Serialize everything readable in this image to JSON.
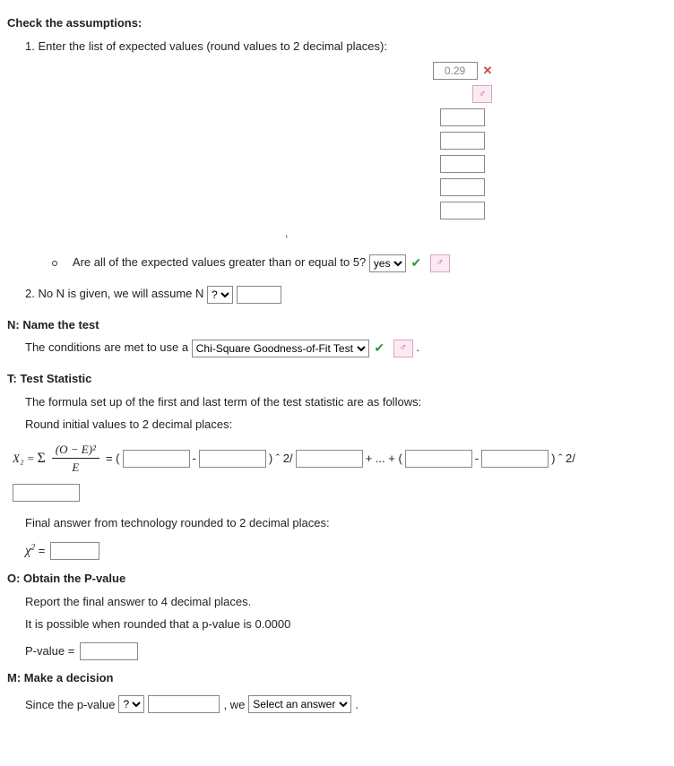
{
  "headings": {
    "check": "Check the assumptions:",
    "enter_list": "1. Enter the list of expected values (round values to 2 decimal places):",
    "all_ge5": "Are all of the expected values greater than or equal to 5?",
    "no_n": "2. No N is given, we will assume N",
    "name": "N: Name the test",
    "conditions": "The conditions are met to use a",
    "ts": "T: Test Statistic",
    "formula_intro": "The formula set up of the first and last term of the test statistic are as follows:",
    "round_initial": "Round initial values to 2 decimal places:",
    "final_tech": "Final answer from technology rounded to 2 decimal places:",
    "obtain": "O: Obtain the P-value",
    "report4": "Report the final answer to 4 decimal places.",
    "possible0": "It is possible when rounded that a p-value is 0.0000",
    "pval_label": "P-value =",
    "make": "M: Make a decision",
    "since": "Since the p-value",
    "we": ", we"
  },
  "inputs": {
    "ev0": "0.29",
    "ev1": "",
    "ev2": "",
    "ev3": "",
    "ev4": "",
    "ev5": "",
    "assume_val": "",
    "o1": "",
    "e1": "",
    "d1": "",
    "o2": "",
    "e2": "",
    "d2": "",
    "below": "",
    "chi_val": "",
    "pval": "",
    "compare_val": ""
  },
  "selects": {
    "ge5": {
      "selected": "yes",
      "options": [
        "yes",
        "no"
      ]
    },
    "assume": {
      "selected": "?",
      "options": [
        "?",
        "≥",
        "<"
      ]
    },
    "test_name": {
      "selected": "Chi-Square Goodness-of-Fit Test",
      "options": [
        "Chi-Square Goodness-of-Fit Test",
        "Chi-Square Test of Independence"
      ]
    },
    "compare": {
      "selected": "?",
      "options": [
        "?",
        "is less than",
        "is greater than"
      ]
    },
    "decision": {
      "selected": "Select an answer",
      "options": [
        "Select an answer",
        "reject the null hypothesis",
        "fail to reject the null hypothesis"
      ]
    }
  },
  "symbols": {
    "dot": ".",
    "comma": ",",
    "male": "♂",
    "x2_eq": "X₂ = ",
    "sigma": "Σ",
    "oe_num": "(O − E)²",
    "oe_den": "E",
    "eq": " = (",
    "minus": "-",
    "close_sq_div": ") ˆ 2/",
    "plus_ell": "+ ... + (",
    "close_sq_div2": ") ˆ 2/",
    "chi2_eq": "χ",
    "sup2": "2",
    "equals": "="
  }
}
